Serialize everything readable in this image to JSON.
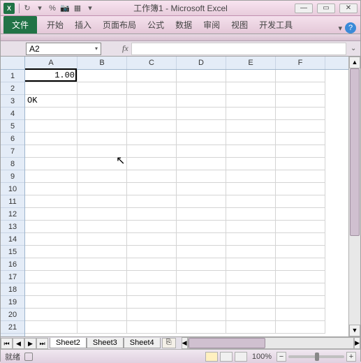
{
  "title": "工作簿1 - Microsoft Excel",
  "app_icon_label": "X",
  "qat": {
    "percent": "%",
    "camera": "📷",
    "table": "▦"
  },
  "win": {
    "min": "—",
    "max": "▭",
    "close": "✕"
  },
  "ribbon": {
    "file": "文件",
    "tabs": [
      "开始",
      "插入",
      "页面布局",
      "公式",
      "数据",
      "审阅",
      "视图",
      "开发工具"
    ],
    "help": "?",
    "collapse": "▾"
  },
  "namebox": {
    "value": "A2",
    "dropdown": "▾"
  },
  "fx": "fx",
  "columns": [
    "A",
    "B",
    "C",
    "D",
    "E",
    "F"
  ],
  "rows": [
    "1",
    "2",
    "3",
    "4",
    "5",
    "6",
    "7",
    "8",
    "9",
    "10",
    "11",
    "12",
    "13",
    "14",
    "15",
    "16",
    "17",
    "18",
    "19",
    "20",
    "21"
  ],
  "cells": {
    "A1": "1.00",
    "A3": "OK"
  },
  "selection": {
    "cell": "A2"
  },
  "sheet_nav": {
    "first": "⏮",
    "prev": "◀",
    "next": "▶",
    "last": "⏭"
  },
  "sheets": [
    "Sheet2",
    "Sheet3",
    "Sheet4"
  ],
  "new_sheet": "⎘",
  "scroll": {
    "up": "▲",
    "down": "▼",
    "left": "◀",
    "right": "▶"
  },
  "status": {
    "ready": "就绪",
    "zoom": "100%",
    "minus": "−",
    "plus": "+"
  },
  "chart_data": {
    "type": "table",
    "columns": [
      "A",
      "B",
      "C",
      "D",
      "E",
      "F"
    ],
    "rows": [
      [
        "1.00",
        "",
        "",
        "",
        "",
        ""
      ],
      [
        "",
        "",
        "",
        "",
        "",
        ""
      ],
      [
        "OK",
        "",
        "",
        "",
        "",
        ""
      ]
    ]
  }
}
